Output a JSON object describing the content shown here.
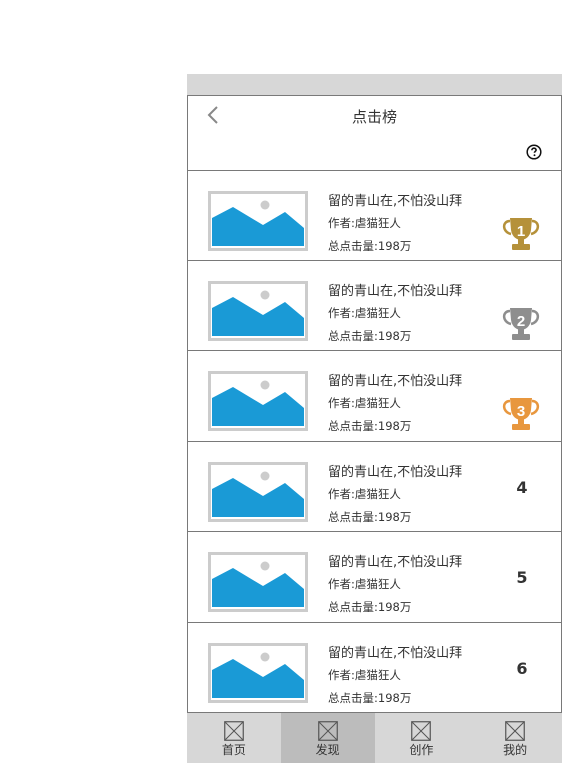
{
  "header": {
    "title": "点击榜",
    "back_icon": "chevron-left-icon"
  },
  "subheader": {
    "help_icon": "question-circle-icon"
  },
  "colors": {
    "gold": "#b5913a",
    "silver": "#8e8e8e",
    "bronze": "#e8973e",
    "image_blue": "#1a9ad6",
    "active_tab": "#bcbcbc"
  },
  "ranking": [
    {
      "title": "留的青山在,不怕没山拜",
      "author": "作者:虐猫狂人",
      "clicks": "总点击量:198万",
      "rank": "1",
      "trophy": "gold"
    },
    {
      "title": "留的青山在,不怕没山拜",
      "author": "作者:虐猫狂人",
      "clicks": "总点击量:198万",
      "rank": "2",
      "trophy": "silver"
    },
    {
      "title": "留的青山在,不怕没山拜",
      "author": "作者:虐猫狂人",
      "clicks": "总点击量:198万",
      "rank": "3",
      "trophy": "bronze"
    },
    {
      "title": "留的青山在,不怕没山拜",
      "author": "作者:虐猫狂人",
      "clicks": "总点击量:198万",
      "rank": "4",
      "trophy": ""
    },
    {
      "title": "留的青山在,不怕没山拜",
      "author": "作者:虐猫狂人",
      "clicks": "总点击量:198万",
      "rank": "5",
      "trophy": ""
    },
    {
      "title": "留的青山在,不怕没山拜",
      "author": "作者:虐猫狂人",
      "clicks": "总点击量:198万",
      "rank": "6",
      "trophy": ""
    }
  ],
  "tabs": [
    {
      "label": "首页",
      "active": false
    },
    {
      "label": "发现",
      "active": true
    },
    {
      "label": "创作",
      "active": false
    },
    {
      "label": "我的",
      "active": false
    }
  ]
}
